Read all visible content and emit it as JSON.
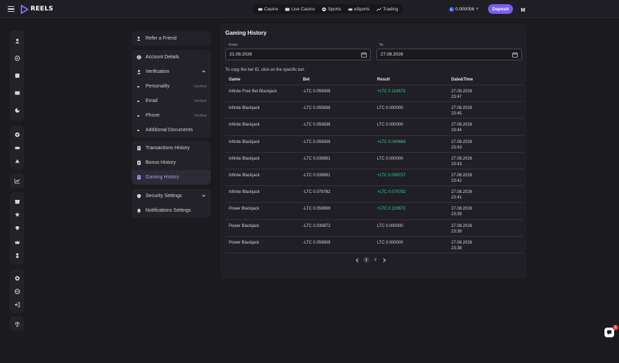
{
  "topbar": {
    "brand": "REELS",
    "nav": [
      {
        "label": "Casino",
        "icon": "casino-icon"
      },
      {
        "label": "Live Casino",
        "icon": "live-casino-icon"
      },
      {
        "label": "Sports",
        "icon": "sports-icon"
      },
      {
        "label": "eSports",
        "icon": "esports-icon"
      },
      {
        "label": "Trading",
        "icon": "trading-icon"
      }
    ],
    "balance": "0.000056",
    "balance_currency_glyph": "Ł",
    "deposit_label": "Deposit"
  },
  "menu": {
    "refer_label": "Refer a Friend",
    "account_details": "Account Details",
    "verification": "Verification",
    "verification_items": [
      {
        "label": "Personality",
        "status": "Verified"
      },
      {
        "label": "Email",
        "status": "Verified"
      },
      {
        "label": "Phone",
        "status": "Verified"
      },
      {
        "label": "Additional Documents",
        "status": ""
      }
    ],
    "transactions_history": "Transactions History",
    "bonus_history": "Bonus History",
    "gaming_history": "Gaming History",
    "security_settings": "Security Settings",
    "notifications_settings": "Notifications Settings"
  },
  "gaming_history": {
    "title": "Gaming History",
    "from_label": "From",
    "from_value": "21.08.2026",
    "to_label": "To",
    "to_value": "27.08.2026",
    "hint": "To copy the bet ID, click on the specific bet.",
    "columns": [
      "Game",
      "Bet",
      "Result",
      "Date&Time"
    ],
    "rows": [
      {
        "game": "Infinite Free Bet Blackjack",
        "bet": "-LTC  0.059836",
        "result": "+LTC  0.119673",
        "win": true,
        "date": "27.08.2026",
        "time": "23:47"
      },
      {
        "game": "Infinite Blackjack",
        "bet": "-LTC  0.059836",
        "result": "LTC  0.000000",
        "win": false,
        "date": "27.08.2026",
        "time": "23:45"
      },
      {
        "game": "Infinite Blackjack",
        "bet": "-LTC  0.059836",
        "result": "LTC  0.000000",
        "win": false,
        "date": "27.08.2026",
        "time": "23:44"
      },
      {
        "game": "Infinite Blackjack",
        "bet": "-LTC  0.059836",
        "result": "+LTC  0.040689",
        "win": true,
        "date": "27.08.2026",
        "time": "23:43"
      },
      {
        "game": "Infinite Blackjack",
        "bet": "-LTC  0.039891",
        "result": "LTC  0.000000",
        "win": false,
        "date": "27.08.2026",
        "time": "23:43"
      },
      {
        "game": "Infinite Blackjack",
        "bet": "-LTC  0.039891",
        "result": "+LTC  0.099727",
        "win": true,
        "date": "27.08.2026",
        "time": "23:42"
      },
      {
        "game": "Infinite Blackjack",
        "bet": "-LTC  0.079782",
        "result": "+LTC  0.079782",
        "win": true,
        "date": "27.08.2026",
        "time": "23:41"
      },
      {
        "game": "Power Blackjack",
        "bet": "-LTC  0.059808",
        "result": "+LTC  0.119673",
        "win": true,
        "date": "27.08.2026",
        "time": "23:39"
      },
      {
        "game": "Power Blackjack",
        "bet": "-LTC  0.039872",
        "result": "LTC  0.000000",
        "win": false,
        "date": "27.08.2026",
        "time": "23:39"
      },
      {
        "game": "Power Blackjack",
        "bet": "-LTC  0.059808",
        "result": "LTC  0.000000",
        "win": false,
        "date": "27.08.2026",
        "time": "23:38"
      }
    ],
    "pages": [
      "1",
      "2"
    ],
    "current_page": "1"
  },
  "chat": {
    "badge": "1"
  },
  "colors": {
    "accent": "#7b5cf0",
    "win": "#3bcf8e",
    "background": "#1b1a1f",
    "panel": "#201f25"
  }
}
